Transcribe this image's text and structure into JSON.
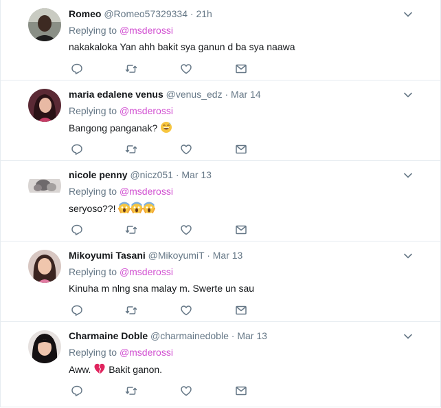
{
  "replying_label": "Replying to",
  "colors": {
    "mention": "#d14fd1",
    "name": "#14171a",
    "meta": "#657786",
    "icon": "#657786",
    "divider": "#e6ecf0"
  },
  "tweets": [
    {
      "fullname": "Romeo",
      "username": "@Romeo57329334",
      "time": "21h",
      "mention": "@msderossi",
      "text": "nakakaloka Yan ahh bakit sya ganun d ba sya naawa",
      "emojis": []
    },
    {
      "fullname": "maria edalene venus",
      "username": "@venus_edz",
      "time": "Mar 14",
      "mention": "@msderossi",
      "text": "Bangong panganak?",
      "emojis": [
        "grinning-sweat-emoji"
      ]
    },
    {
      "fullname": "nicole penny",
      "username": "@nicz051",
      "time": "Mar 13",
      "mention": "@msderossi",
      "text": "seryoso??!",
      "emojis": [
        "screaming-face-emoji",
        "screaming-face-emoji",
        "screaming-face-emoji"
      ]
    },
    {
      "fullname": "Mikoyumi Tasani",
      "username": "@MikoyumiT",
      "time": "Mar 13",
      "mention": "@msderossi",
      "text": "Kinuha m nlng sna malay m. Swerte un sau",
      "emojis": []
    },
    {
      "fullname": "Charmaine Doble",
      "username": "@charmainedoble",
      "time": "Mar 13",
      "mention": "@msderossi",
      "text_before": "Aww.",
      "text": "Bakit ganon.",
      "emojis": [
        "broken-heart-emoji"
      ]
    }
  ]
}
